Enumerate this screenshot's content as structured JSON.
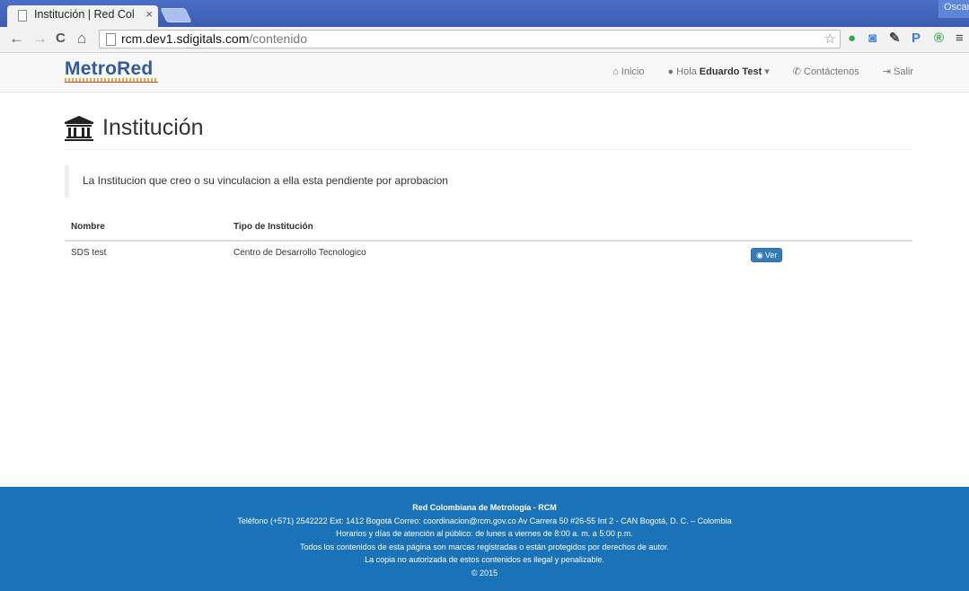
{
  "browser": {
    "tab_title": "Institución | Red Col",
    "tab_close": "×",
    "window_user": "Oscar",
    "url_host": "rcm.dev1.sdigitals.com",
    "url_path": "/contenido",
    "back": "←",
    "forward": "→",
    "reload": "C",
    "home": "⌂",
    "star": "☆",
    "extensions": [
      {
        "glyph": "●",
        "color": "#2eaa4a",
        "name": "evernote-icon"
      },
      {
        "glyph": "◙",
        "color": "#4a8ad8",
        "name": "camera-icon"
      },
      {
        "glyph": "✎",
        "color": "#444444",
        "name": "eyedropper-icon"
      },
      {
        "glyph": "P",
        "color": "#3a7bd5",
        "name": "pushbullet-icon"
      },
      {
        "glyph": "®",
        "color": "#2eaa4a",
        "name": "extension-r-icon"
      },
      {
        "glyph": "≡",
        "color": "#444444",
        "name": "menu-icon"
      }
    ]
  },
  "nav": {
    "logo": "MetroRed",
    "inicio": "Inicio",
    "hola": "Hola",
    "user_name": "Eduardo Test",
    "contactenos": "Contáctenos",
    "salir": "Salir"
  },
  "page": {
    "title": "Institución",
    "notice": "La Institucion que creo o su vinculacion a ella esta pendiente por aprobacion"
  },
  "table": {
    "headers": [
      "Nombre",
      "Tipo de Institución"
    ],
    "rows": [
      {
        "nombre": "SDS test",
        "tipo": "Centro de Desarrollo Tecnologico",
        "action": "Ver"
      }
    ]
  },
  "footer": {
    "title": "Red Colombiana de Metrología - RCM",
    "line1": "Teléfono (+571) 2542222 Ext: 1412 Bogotá Correo: coordinacion@rcm.gov.co Av Carrera 50 #26-55 Int 2 - CAN Bogotá, D. C. – Colombia",
    "line2": "Horarios y días de atención al público: de lunes a viernes de 8:00 a. m. a 5:00 p.m.",
    "line3": "Todos los contenidos de esta página son marcas registradas o están protegidos por derechos de autor.",
    "line4": "La copia no autorizada de estos contenidos es ilegal y penalizable.",
    "copyright": "© 2015"
  }
}
